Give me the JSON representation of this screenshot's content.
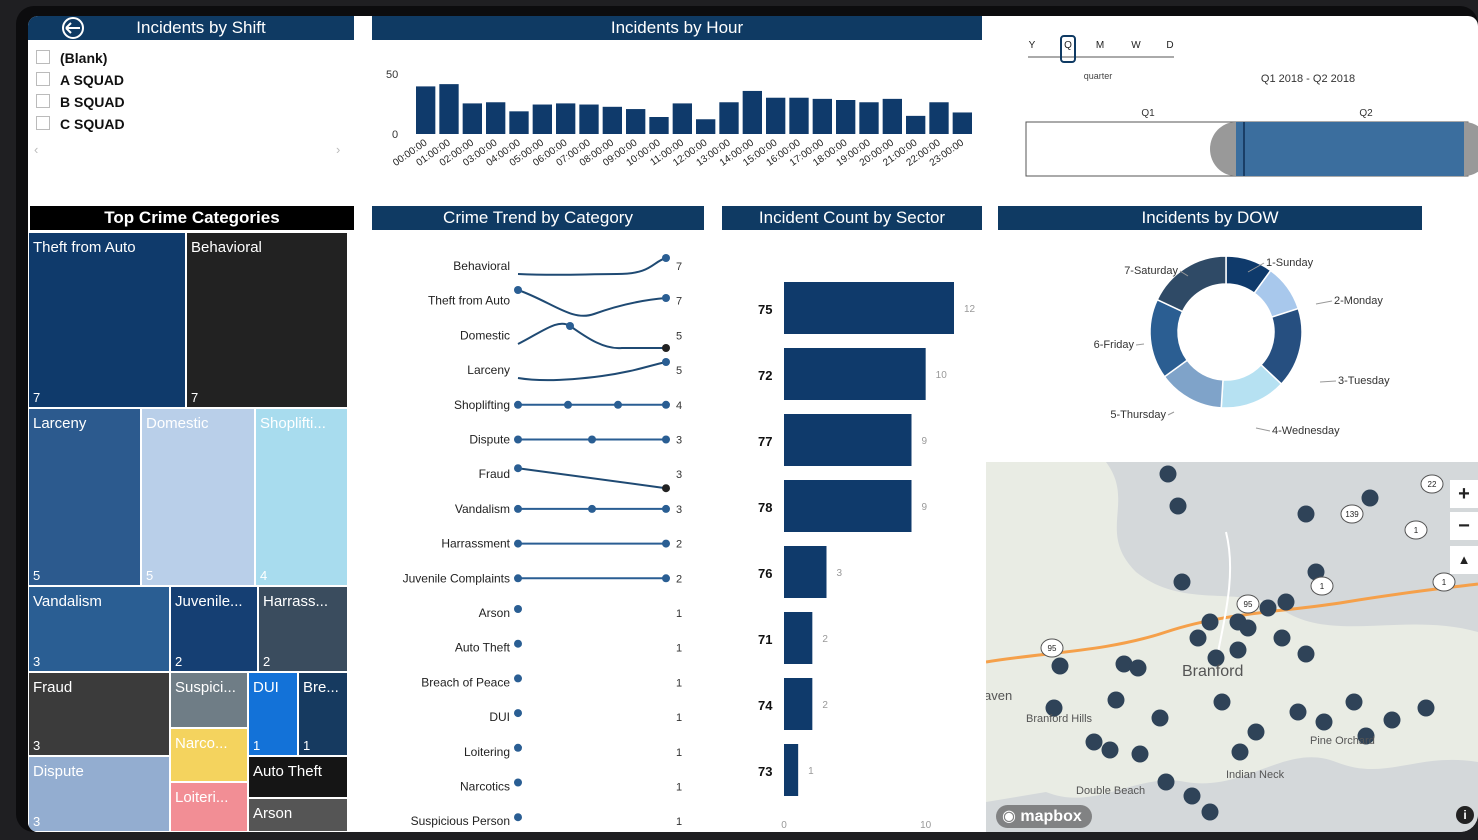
{
  "shift_slicer": {
    "title": "Incidents by Shift",
    "items": [
      "(Blank)",
      "A SQUAD",
      "B SQUAD",
      "C SQUAD"
    ]
  },
  "hour_chart": {
    "title": "Incidents by Hour",
    "y_ticks": [
      "50",
      "0"
    ]
  },
  "date_slicer": {
    "granularity": [
      "Y",
      "Q",
      "M",
      "W",
      "D"
    ],
    "selected": "Q",
    "mode_label": "quarter",
    "range_label": "Q1 2018 - Q2 2018",
    "periods": [
      "Q1",
      "Q2"
    ]
  },
  "treemap": {
    "title": "Top Crime Categories",
    "tiles": [
      {
        "label": "Theft from Auto",
        "value": "7",
        "color": "#0f3a6b"
      },
      {
        "label": "Behavioral",
        "value": "7",
        "color": "#222222"
      },
      {
        "label": "Larceny",
        "value": "5",
        "color": "#2c5a8e"
      },
      {
        "label": "Domestic",
        "value": "5",
        "color": "#b9cfe9"
      },
      {
        "label": "Shoplifti...",
        "value": "4",
        "color": "#a8dcee"
      },
      {
        "label": "Vandalism",
        "value": "3",
        "color": "#2a5e93"
      },
      {
        "label": "Juvenile...",
        "value": "2",
        "color": "#153f73"
      },
      {
        "label": "Harrass...",
        "value": "2",
        "color": "#3a4c5e"
      },
      {
        "label": "Fraud",
        "value": "3",
        "color": "#3b3b3b"
      },
      {
        "label": "Suspici...",
        "value": "",
        "color": "#6f7d86"
      },
      {
        "label": "DUI",
        "value": "1",
        "color": "#1372d8"
      },
      {
        "label": "Bre...",
        "value": "1",
        "color": "#163a60"
      },
      {
        "label": "Narco...",
        "value": "",
        "color": "#f4d35e"
      },
      {
        "label": "Dispute",
        "value": "3",
        "color": "#93add0"
      },
      {
        "label": "Loiteri...",
        "value": "",
        "color": "#f28e95"
      },
      {
        "label": "Auto Theft",
        "value": "",
        "color": "#151515"
      },
      {
        "label": "Arson",
        "value": "",
        "color": "#555555"
      }
    ]
  },
  "trend": {
    "title": "Crime Trend by Category",
    "rows": [
      {
        "label": "Behavioral",
        "value": "7"
      },
      {
        "label": "Theft from Auto",
        "value": "7"
      },
      {
        "label": "Domestic",
        "value": "5"
      },
      {
        "label": "Larceny",
        "value": "5"
      },
      {
        "label": "Shoplifting",
        "value": "4"
      },
      {
        "label": "Dispute",
        "value": "3"
      },
      {
        "label": "Fraud",
        "value": "3"
      },
      {
        "label": "Vandalism",
        "value": "3"
      },
      {
        "label": "Harrassment",
        "value": "2"
      },
      {
        "label": "Juvenile Complaints",
        "value": "2"
      },
      {
        "label": "Arson",
        "value": "1"
      },
      {
        "label": "Auto Theft",
        "value": "1"
      },
      {
        "label": "Breach of Peace",
        "value": "1"
      },
      {
        "label": "DUI",
        "value": "1"
      },
      {
        "label": "Loitering",
        "value": "1"
      },
      {
        "label": "Narcotics",
        "value": "1"
      },
      {
        "label": "Suspicious Person",
        "value": "1"
      }
    ]
  },
  "sector_chart": {
    "title": "Incident Count by Sector",
    "x_ticks": [
      "0",
      "10"
    ]
  },
  "dow_chart": {
    "title": "Incidents by DOW",
    "labels": [
      "1-Sunday",
      "2-Monday",
      "3-Tuesday",
      "4-Wednesday",
      "5-Thursday",
      "6-Friday",
      "7-Saturday"
    ]
  },
  "map": {
    "places": [
      "Branford",
      "Branford Hills",
      "Pine Orchard",
      "Indian Neck",
      "Double Beach",
      "aven"
    ],
    "shields": [
      "139",
      "1",
      "95",
      "22",
      "1",
      "1",
      "95"
    ],
    "logo": "mapbox",
    "zoom_in": "+",
    "zoom_out": "−",
    "compass": "▲",
    "info": "i"
  },
  "chart_data": [
    {
      "type": "bar",
      "title": "Incidents by Hour",
      "categories": [
        "00:00:00",
        "01:00:00",
        "02:00:00",
        "03:00:00",
        "04:00:00",
        "05:00:00",
        "06:00:00",
        "07:00:00",
        "08:00:00",
        "09:00:00",
        "10:00:00",
        "11:00:00",
        "12:00:00",
        "13:00:00",
        "14:00:00",
        "15:00:00",
        "16:00:00",
        "17:00:00",
        "18:00:00",
        "19:00:00",
        "20:00:00",
        "21:00:00",
        "22:00:00",
        "23:00:00"
      ],
      "values": [
        42,
        44,
        27,
        28,
        20,
        26,
        27,
        26,
        24,
        22,
        15,
        27,
        13,
        28,
        38,
        32,
        32,
        31,
        30,
        28,
        31,
        16,
        28,
        19
      ],
      "ylim": [
        0,
        60
      ],
      "colors": {
        "bar": "#0f3a6b"
      }
    },
    {
      "type": "bar",
      "orientation": "horizontal",
      "title": "Incident Count by Sector",
      "categories": [
        "75",
        "72",
        "77",
        "78",
        "76",
        "71",
        "74",
        "73"
      ],
      "values": [
        12,
        10,
        9,
        9,
        3,
        2,
        2,
        1
      ],
      "xlim": [
        0,
        14
      ],
      "colors": {
        "bar": "#0f3a6b"
      }
    },
    {
      "type": "pie",
      "title": "Incidents by DOW",
      "categories": [
        "1-Sunday",
        "2-Monday",
        "3-Tuesday",
        "4-Wednesday",
        "5-Thursday",
        "6-Friday",
        "7-Saturday"
      ],
      "values": [
        10,
        10,
        17,
        14,
        14,
        17,
        18
      ],
      "colors": [
        "#0f3a6b",
        "#a8c8ec",
        "#264f80",
        "#b6e1f2",
        "#7fa3c9",
        "#2b5e92",
        "#2f4a66"
      ]
    }
  ]
}
